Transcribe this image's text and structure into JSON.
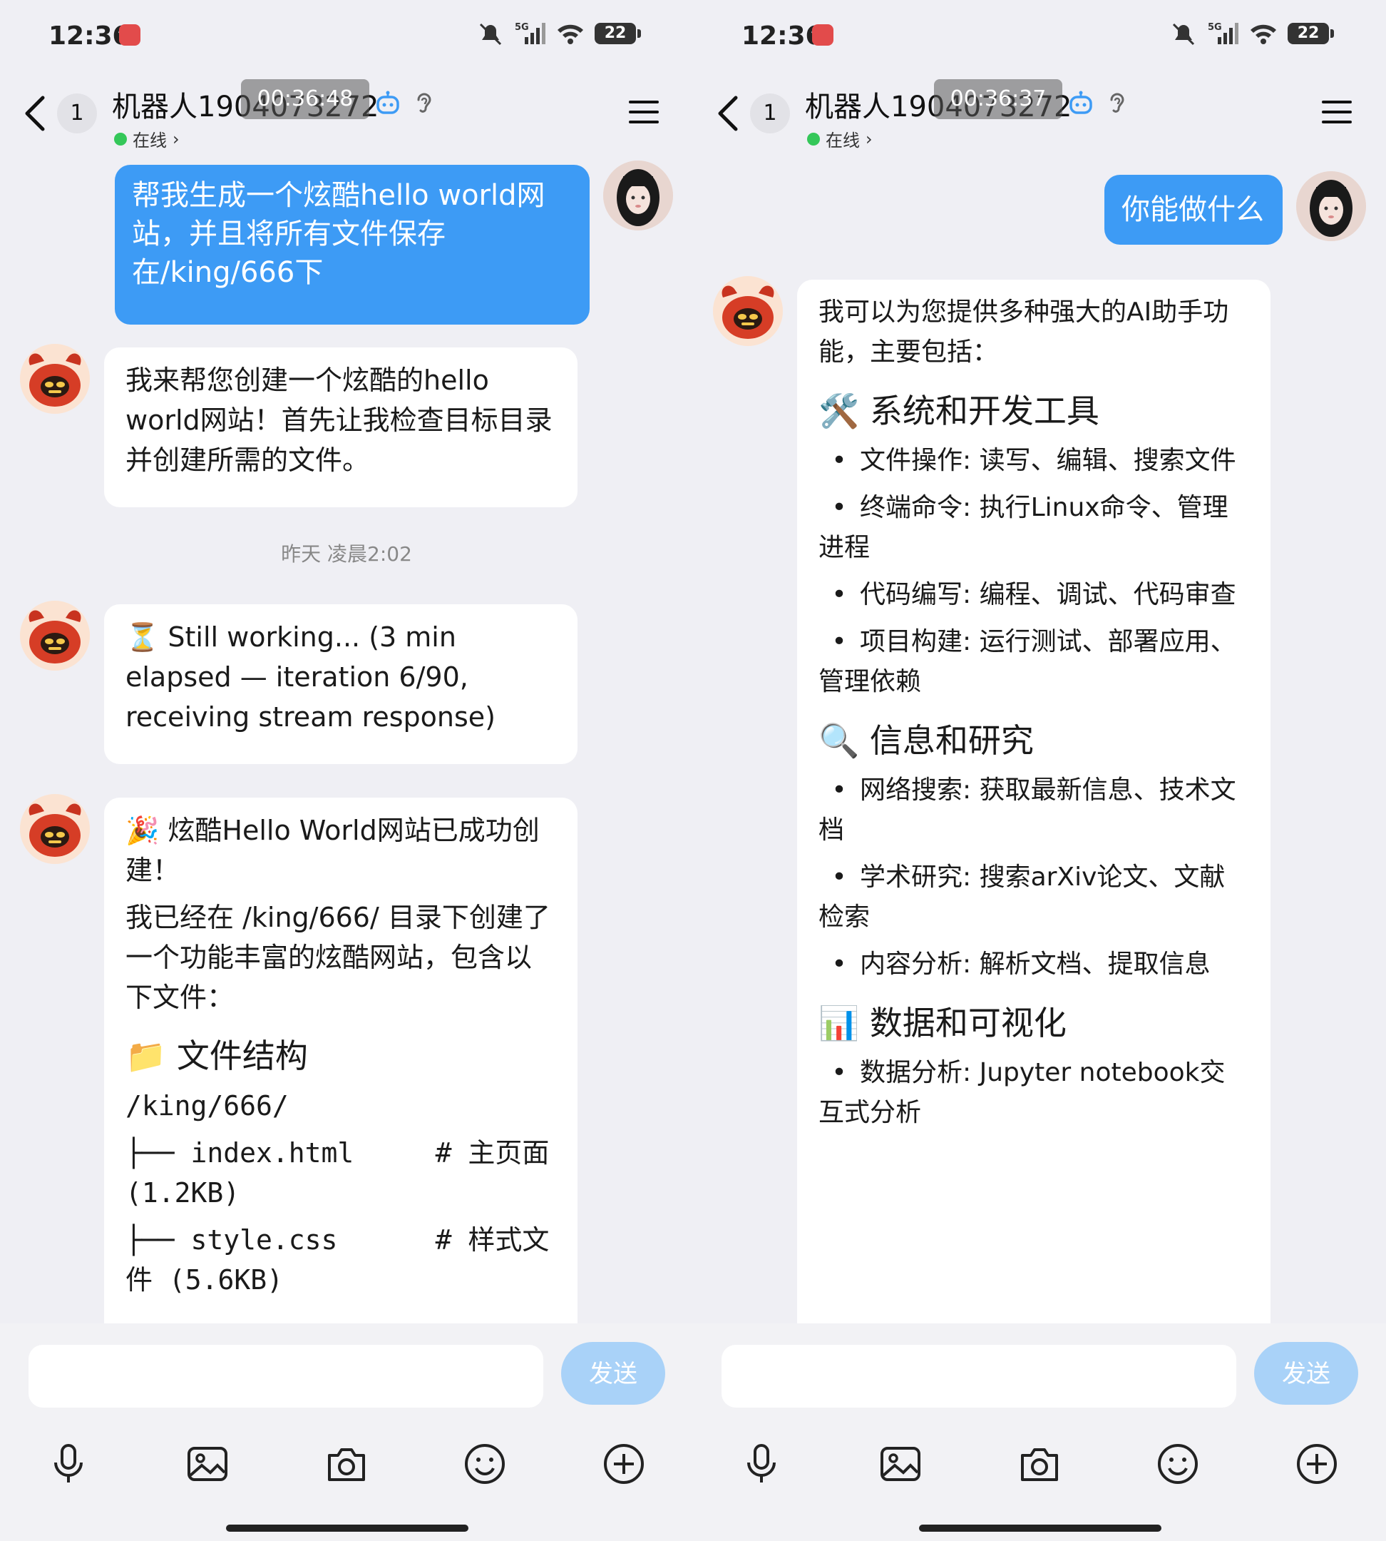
{
  "status": {
    "time": "12:36",
    "network": "5G",
    "battery": "22"
  },
  "header": {
    "back_count": "1",
    "title_left": "机器人1904073272",
    "title_right": "机器人1904073272",
    "timer_left": "00:36:48",
    "timer_right": "00:36:37",
    "online": "在线",
    "online_chevron": "›"
  },
  "left": {
    "user_msg": "帮我生成一个炫酷hello world网站，并且将所有文件保存在/king/666下",
    "bot1": "我来帮您创建一个炫酷的hello world网站！首先让我检查目标目录并创建所需的文件。",
    "timestamp": "昨天 凌晨2:02",
    "bot2": "⏳ Still working... (3 min elapsed — iteration 6/90, receiving stream response)",
    "bot3_title": "🎉 炫酷Hello World网站已成功创建！",
    "bot3_intro": "我已经在 /king/666/ 目录下创建了一个功能丰富的炫酷网站，包含以下文件：",
    "bot3_heading": "📁 文件结构",
    "tree_root": "/king/666/",
    "tree_line1": "├── index.html     # 主页面 (1.2KB)",
    "tree_line2": "├── style.css      # 样式文件 (5.6KB)"
  },
  "right": {
    "user_msg": "你能做什么",
    "intro": "我可以为您提供多种强大的AI助手功能，主要包括：",
    "sections": [
      {
        "icon": "🛠️",
        "title": "系统和开发工具",
        "items": [
          "文件操作: 读写、编辑、搜索文件",
          "终端命令: 执行Linux命令、管理进程",
          "代码编写: 编程、调试、代码审查",
          "项目构建: 运行测试、部署应用、管理依赖"
        ]
      },
      {
        "icon": "🔍",
        "title": "信息和研究",
        "items": [
          "网络搜索: 获取最新信息、技术文档",
          "学术研究: 搜索arXiv论文、文献检索",
          "内容分析: 解析文档、提取信息"
        ]
      },
      {
        "icon": "📊",
        "title": "数据和可视化",
        "items": [
          "数据分析: Jupyter notebook交互式分析"
        ]
      }
    ]
  },
  "composer": {
    "placeholder": "",
    "send_label": "发送"
  },
  "colors": {
    "accent": "#3d9bf5",
    "send_disabled": "#a9d2f8",
    "online": "#34c759"
  },
  "icons": [
    "back-arrow-icon",
    "robot-icon",
    "ear-icon",
    "menu-icon",
    "microphone-icon",
    "image-icon",
    "camera-icon",
    "emoji-icon",
    "plus-icon"
  ]
}
